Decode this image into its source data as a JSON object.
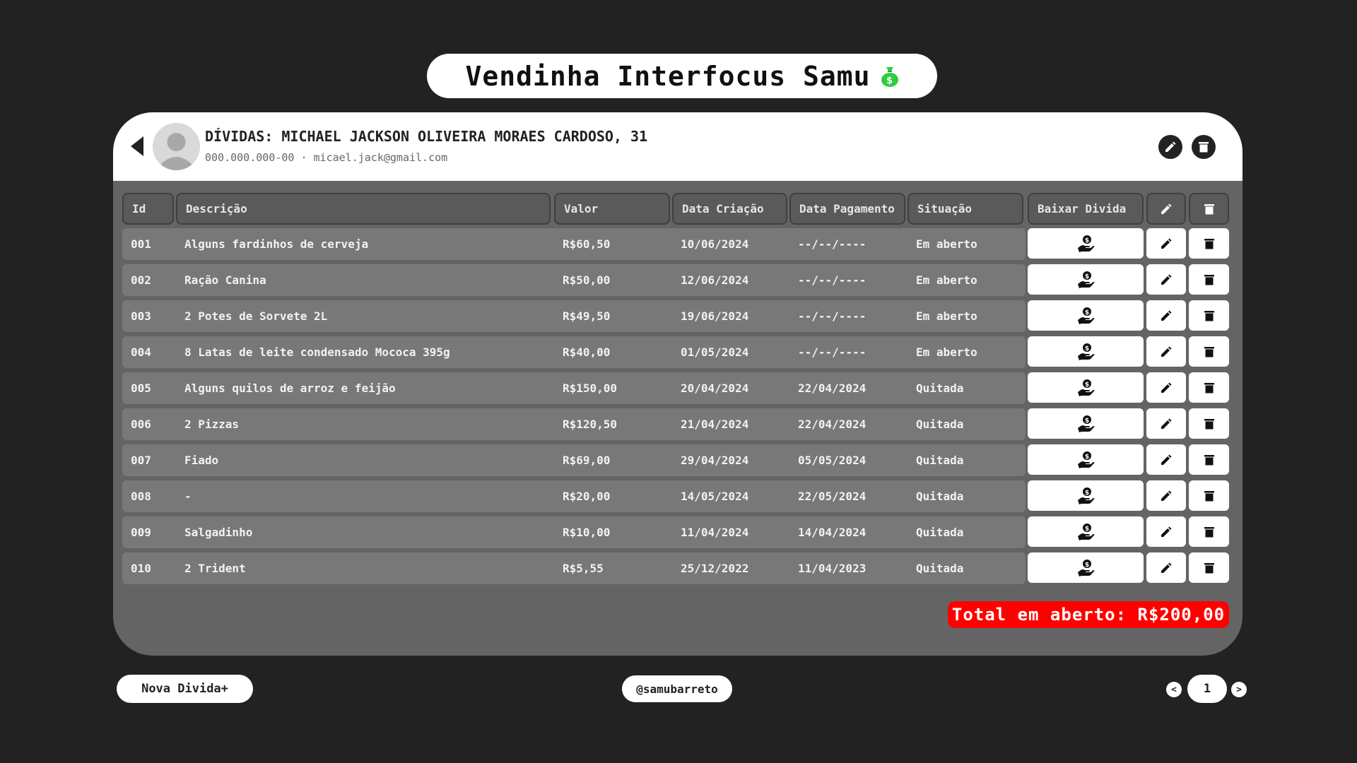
{
  "app": {
    "title": "Vendinha Interfocus Samu",
    "title_icon": "money-bag-icon"
  },
  "client": {
    "heading": "DÍVIDAS: MICHAEL JACKSON OLIVEIRA MORAES CARDOSO, 31",
    "cpf": "000.000.000-00",
    "separator": "·",
    "email": "micael.jack@gmail.com"
  },
  "table": {
    "headers": {
      "id": "Id",
      "desc": "Descrição",
      "val": "Valor",
      "dc": "Data Criação",
      "dp": "Data Pagamento",
      "sit": "Situação",
      "baixar": "Baixar Divida"
    },
    "rows": [
      {
        "id": "001",
        "desc": "Alguns fardinhos de cerveja",
        "val": "R$60,50",
        "dc": "10/06/2024",
        "dp": "--/--/----",
        "sit": "Em aberto"
      },
      {
        "id": "002",
        "desc": "Ração Canina",
        "val": "R$50,00",
        "dc": "12/06/2024",
        "dp": "--/--/----",
        "sit": "Em aberto"
      },
      {
        "id": "003",
        "desc": "2 Potes de Sorvete 2L",
        "val": "R$49,50",
        "dc": "19/06/2024",
        "dp": "--/--/----",
        "sit": "Em aberto"
      },
      {
        "id": "004",
        "desc": "8 Latas de leite condensado Mococa 395g",
        "val": "R$40,00",
        "dc": "01/05/2024",
        "dp": "--/--/----",
        "sit": "Em aberto"
      },
      {
        "id": "005",
        "desc": "Alguns quilos de arroz e feijão",
        "val": "R$150,00",
        "dc": "20/04/2024",
        "dp": "22/04/2024",
        "sit": "Quitada"
      },
      {
        "id": "006",
        "desc": "2 Pizzas",
        "val": "R$120,50",
        "dc": "21/04/2024",
        "dp": "22/04/2024",
        "sit": "Quitada"
      },
      {
        "id": "007",
        "desc": "Fiado",
        "val": "R$69,00",
        "dc": "29/04/2024",
        "dp": "05/05/2024",
        "sit": "Quitada"
      },
      {
        "id": "008",
        "desc": "-",
        "val": "R$20,00",
        "dc": "14/05/2024",
        "dp": "22/05/2024",
        "sit": "Quitada"
      },
      {
        "id": "009",
        "desc": "Salgadinho",
        "val": "R$10,00",
        "dc": "11/04/2024",
        "dp": "14/04/2024",
        "sit": "Quitada"
      },
      {
        "id": "010",
        "desc": "2 Trident",
        "val": "R$5,55",
        "dc": "25/12/2022",
        "dp": "11/04/2023",
        "sit": "Quitada"
      }
    ]
  },
  "total": {
    "label": "Total em aberto: R$200,00"
  },
  "footer": {
    "new_debt": "Nova Divida+",
    "handle": "@samubarreto",
    "page_prev": "<",
    "page_current": "1",
    "page_next": ">"
  },
  "colors": {
    "background": "#222222",
    "card": "#646464",
    "row": "#787878",
    "total": "#ff0000",
    "money_icon": "#2ecc40"
  }
}
